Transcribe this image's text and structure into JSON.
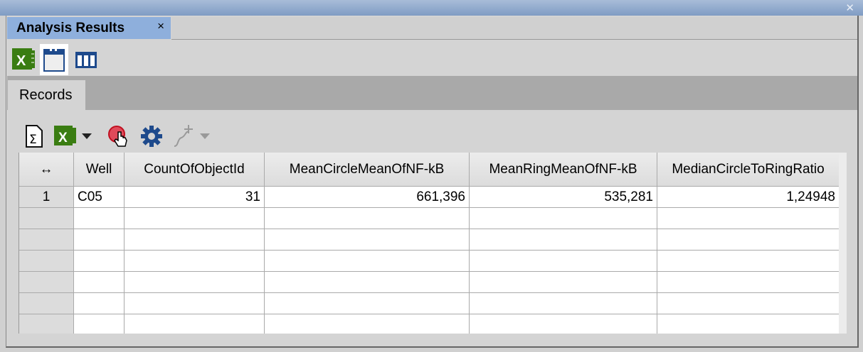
{
  "window": {
    "close_icon": "close-icon"
  },
  "doc_tab": {
    "title": "Analysis Results",
    "close": "×"
  },
  "view_icons": [
    "excel-icon",
    "window-view-icon",
    "columns-view-icon"
  ],
  "subtab": {
    "label": "Records"
  },
  "toolbar": [
    "sum-document-icon",
    "excel-export-dropdown",
    "pointer-select-icon",
    "settings-gear-icon",
    "add-curve-dropdown-disabled"
  ],
  "table": {
    "resize_handle": "↔",
    "columns": [
      "Well",
      "CountOfObjectId",
      "MeanCircleMeanOfNF-kB",
      "MeanRingMeanOfNF-kB",
      "MedianCircleToRingRatio"
    ],
    "rows": [
      {
        "index": "1",
        "cells": [
          "C05",
          "31",
          "661,396",
          "535,281",
          "1,24948"
        ]
      }
    ]
  },
  "colors": {
    "tab_active": "#8eafdc",
    "excel_green": "#3a7d12",
    "icon_blue": "#1e4a8c"
  }
}
